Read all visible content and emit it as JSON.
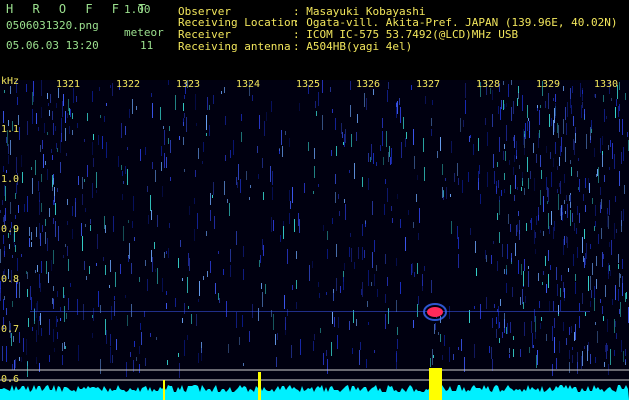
{
  "app": {
    "name": "H R O F F T",
    "version": "1.00"
  },
  "file": {
    "name": "0506031320.png",
    "datetime": "05.06.03 13:20"
  },
  "detection": {
    "label": "meteor",
    "count": "11"
  },
  "info": [
    {
      "key": "Observer",
      "value": ": Masayuki Kobayashi"
    },
    {
      "key": "Receiving Location",
      "value": ": Ogata-vill. Akita-Pref. JAPAN (139.96E, 40.02N)"
    },
    {
      "key": "Receiver",
      "value": ": ICOM IC-575 53.7492(@LCD)MHz USB"
    },
    {
      "key": "Receiving antenna",
      "value": ": A504HB(yagi 4el)"
    }
  ],
  "axes": {
    "y_unit": "kHz",
    "y_ticks": [
      "1.1",
      "1.0",
      "0.9",
      "0.8",
      "0.7",
      "0.6"
    ],
    "x_ticks": [
      "1321",
      "1322",
      "1323",
      "1324",
      "1325",
      "1326",
      "1327",
      "1328",
      "1329",
      "1330"
    ]
  },
  "colors": {
    "background": "#000000",
    "header_text": "#f2e65c",
    "title_green": "#9be08e",
    "signal_noise": "#2b3bd8",
    "meteor_echo": "#ff2a5a",
    "power_trace": "#00f0ff",
    "power_peak": "#ffff00"
  }
}
